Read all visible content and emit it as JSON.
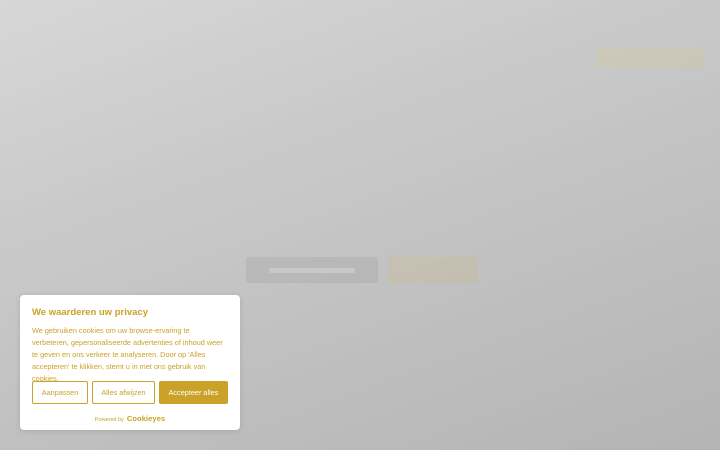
{
  "cookie_banner": {
    "title": "We waarderen uw privacy",
    "text": "We gebruiken cookies om uw browse-ervaring te verbeteren, gepersonaliseerde advertenties of inhoud weer te geven en ons verkeer te analyseren. Door op 'Alles accepteren' te klikken, stemt u in met ons gebruik van cookies.",
    "buttons": {
      "customize": "Aanpassen",
      "reject": "Alles afwijzen",
      "accept": "Accepteer alles"
    },
    "powered_by_label": "Powered by",
    "powered_by_brand": "Cookieyes"
  },
  "colors": {
    "accent": "#c9a227",
    "background": "#cacaca",
    "panel": "#ffffff"
  }
}
